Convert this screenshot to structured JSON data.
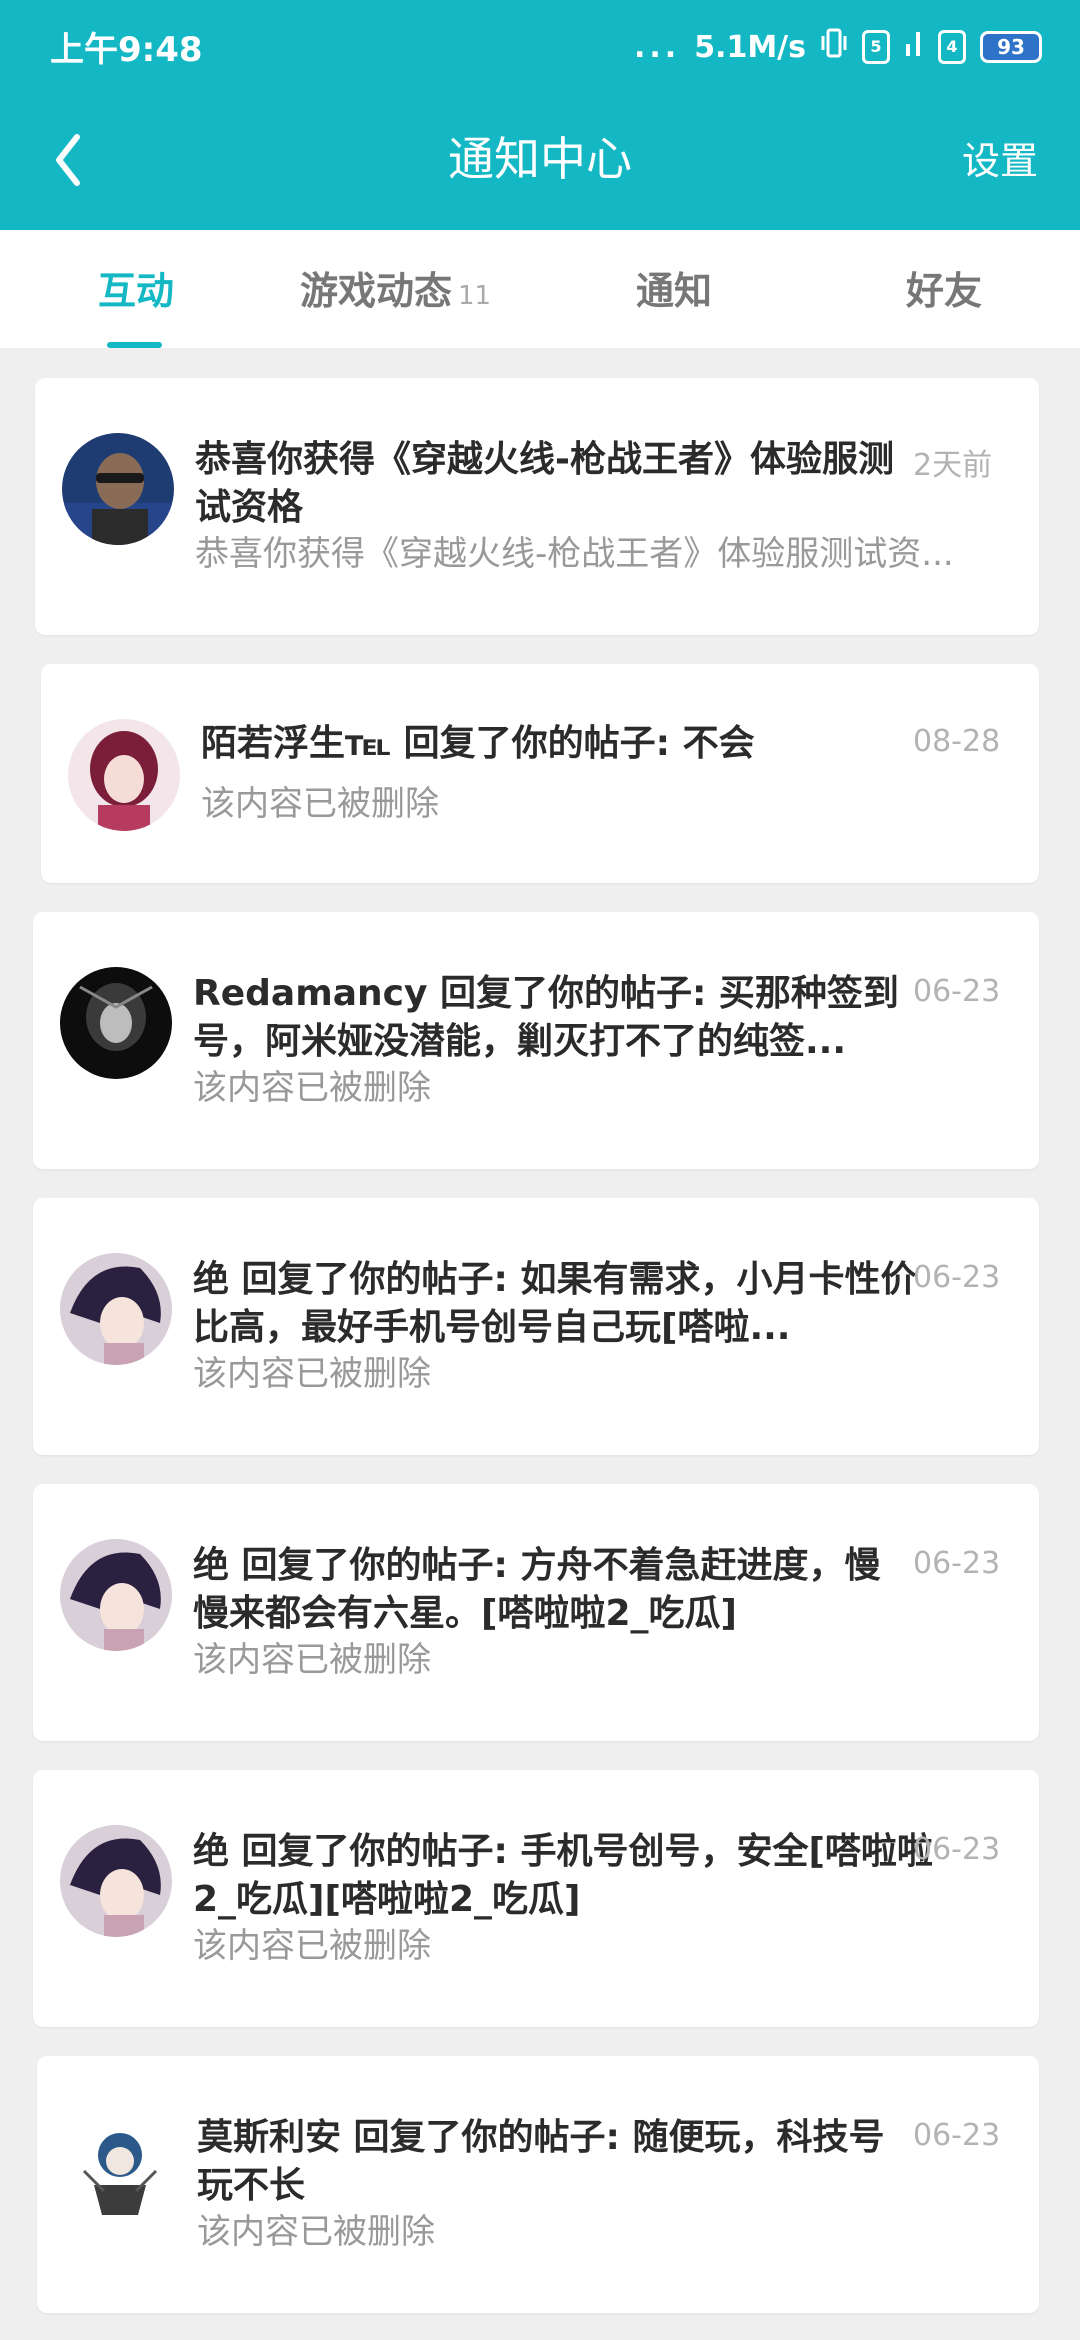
{
  "status_bar": {
    "time": "上午9:48",
    "dots": "...",
    "net_speed": "5.1M/s",
    "sim1": "5",
    "sim2": "4",
    "battery": "93"
  },
  "header": {
    "title": "通知中心",
    "settings_label": "设置"
  },
  "tabs": [
    {
      "label": "互动",
      "active": true
    },
    {
      "label": "游戏动态",
      "count": "11"
    },
    {
      "label": "通知"
    },
    {
      "label": "好友"
    }
  ],
  "notifications": [
    {
      "headline": "恭喜你获得《穿越火线-枪战王者》体验服测试资格",
      "sub": "恭喜你获得《穿越火线-枪战王者》体验服测试资...",
      "time": "2天前"
    },
    {
      "headline": "陌若浮生℡ 回复了你的帖子: 不会",
      "sub": "该内容已被删除",
      "time": "08-28"
    },
    {
      "headline": "Redamancy 回复了你的帖子: 买那种签到号，阿米娅没潜能，剿灭打不了的纯签...",
      "sub": "该内容已被删除",
      "time": "06-23"
    },
    {
      "headline": "绝 回复了你的帖子: 如果有需求，小月卡性价比高，最好手机号创号自己玩[嗒啦...",
      "sub": "该内容已被删除",
      "time": "06-23"
    },
    {
      "headline": "绝 回复了你的帖子: 方舟不着急赶进度，慢慢来都会有六星。[嗒啦啦2_吃瓜]",
      "sub": "该内容已被删除",
      "time": "06-23"
    },
    {
      "headline": "绝 回复了你的帖子: 手机号创号，安全[嗒啦啦2_吃瓜][嗒啦啦2_吃瓜]",
      "sub": "该内容已被删除",
      "time": "06-23"
    },
    {
      "headline": "莫斯利安 回复了你的帖子: 随便玩，科技号玩不长",
      "sub": "该内容已被删除",
      "time": "06-23"
    }
  ]
}
